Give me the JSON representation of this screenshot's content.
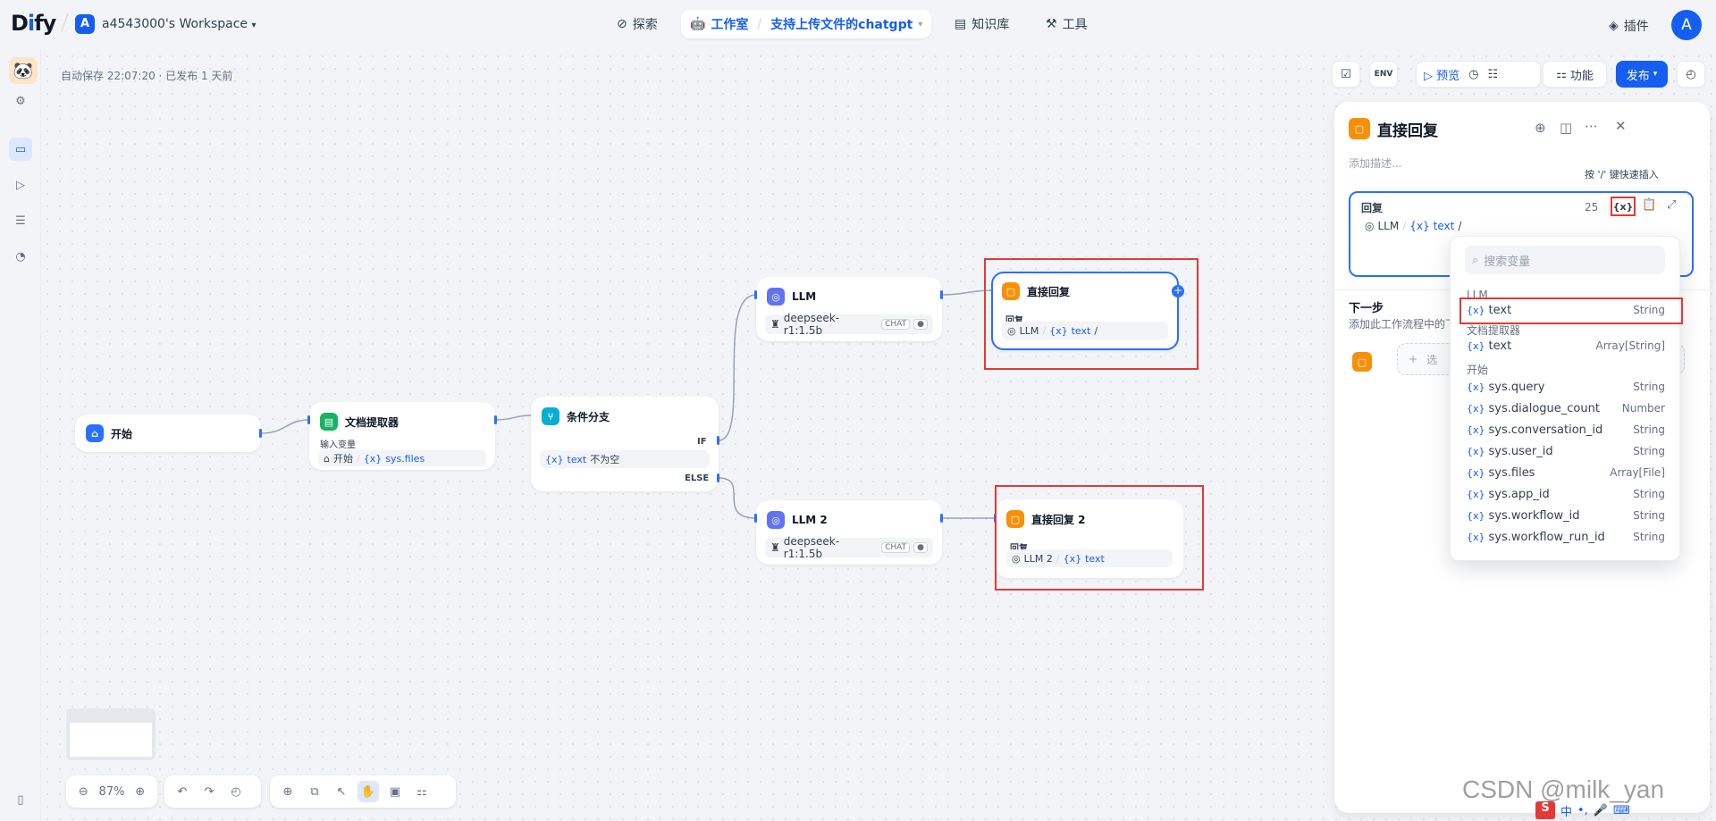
{
  "header": {
    "logo": "Dify",
    "workspace_initial": "A",
    "workspace_name": "a4543000's Workspace",
    "nav": {
      "explore": "探索",
      "studio": "工作室",
      "app_name": "支持上传文件的chatgpt",
      "knowledge": "知识库",
      "tools": "工具"
    },
    "plugins": "插件",
    "user_initial": "A"
  },
  "canvas": {
    "autosave": "自动保存 22:07:20 · 已发布 1 天前",
    "toolbar": {
      "env": "ENV",
      "preview": "预览",
      "features": "功能",
      "publish": "发布"
    },
    "zoom": "87%"
  },
  "nodes": {
    "start": {
      "title": "开始"
    },
    "doc_extractor": {
      "title": "文档提取器",
      "input_label": "输入变量",
      "input_source": "开始",
      "input_var": "sys.files"
    },
    "if_else": {
      "title": "条件分支",
      "if_label": "IF",
      "else_label": "ELSE",
      "cond_var": "text",
      "cond_op": "不为空"
    },
    "llm1": {
      "title": "LLM",
      "model": "deepseek-r1:1.5b",
      "mode": "CHAT"
    },
    "llm2": {
      "title": "LLM 2",
      "model": "deepseek-r1:1.5b",
      "mode": "CHAT"
    },
    "answer1": {
      "title": "直接回复",
      "label": "回复",
      "src": "LLM",
      "var": "text",
      "tail": "/"
    },
    "answer2": {
      "title": "直接回复 2",
      "label": "回复",
      "src": "LLM 2",
      "var": "text"
    }
  },
  "panel": {
    "title": "直接回复",
    "desc_placeholder": "添加描述...",
    "hint": "按 '/' 键快速插入",
    "editor_label": "回复",
    "char_count": "25",
    "content_src": "LLM",
    "content_var": "text",
    "content_tail": "/",
    "next_title": "下一步",
    "next_desc": "添加此工作流程中的下一个节点",
    "select_next": "选"
  },
  "var_picker": {
    "search_placeholder": "搜索变量",
    "groups": [
      {
        "name": "LLM",
        "vars": [
          {
            "name": "text",
            "type": "String"
          }
        ]
      },
      {
        "name": "文档提取器",
        "vars": [
          {
            "name": "text",
            "type": "Array[String]"
          }
        ]
      },
      {
        "name": "开始",
        "vars": [
          {
            "name": "sys.query",
            "type": "String"
          },
          {
            "name": "sys.dialogue_count",
            "type": "Number"
          },
          {
            "name": "sys.conversation_id",
            "type": "String"
          },
          {
            "name": "sys.user_id",
            "type": "String"
          },
          {
            "name": "sys.files",
            "type": "Array[File]"
          },
          {
            "name": "sys.app_id",
            "type": "String"
          },
          {
            "name": "sys.workflow_id",
            "type": "String"
          },
          {
            "name": "sys.workflow_run_id",
            "type": "String"
          }
        ]
      }
    ],
    "var_prefix": "{x}"
  },
  "watermark": "CSDN @milk_yan",
  "ime": {
    "lang": "中"
  }
}
